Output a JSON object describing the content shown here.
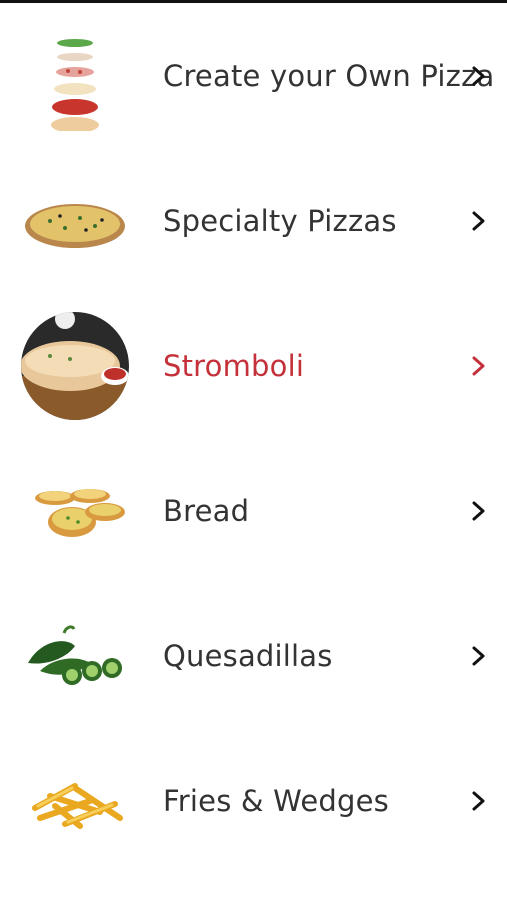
{
  "menu": {
    "items": [
      {
        "label": "Create your Own Pizza",
        "icon": "pizza-layers-icon",
        "active": false
      },
      {
        "label": "Specialty Pizzas",
        "icon": "pizza-icon",
        "active": false
      },
      {
        "label": "Stromboli",
        "icon": "stromboli-icon",
        "active": true
      },
      {
        "label": "Bread",
        "icon": "garlic-bread-icon",
        "active": false
      },
      {
        "label": "Quesadillas",
        "icon": "jalapeno-icon",
        "active": false
      },
      {
        "label": "Fries & Wedges",
        "icon": "fries-icon",
        "active": false
      }
    ]
  },
  "colors": {
    "active": "#c4313a",
    "text": "#333333",
    "chevron": "#111111"
  }
}
